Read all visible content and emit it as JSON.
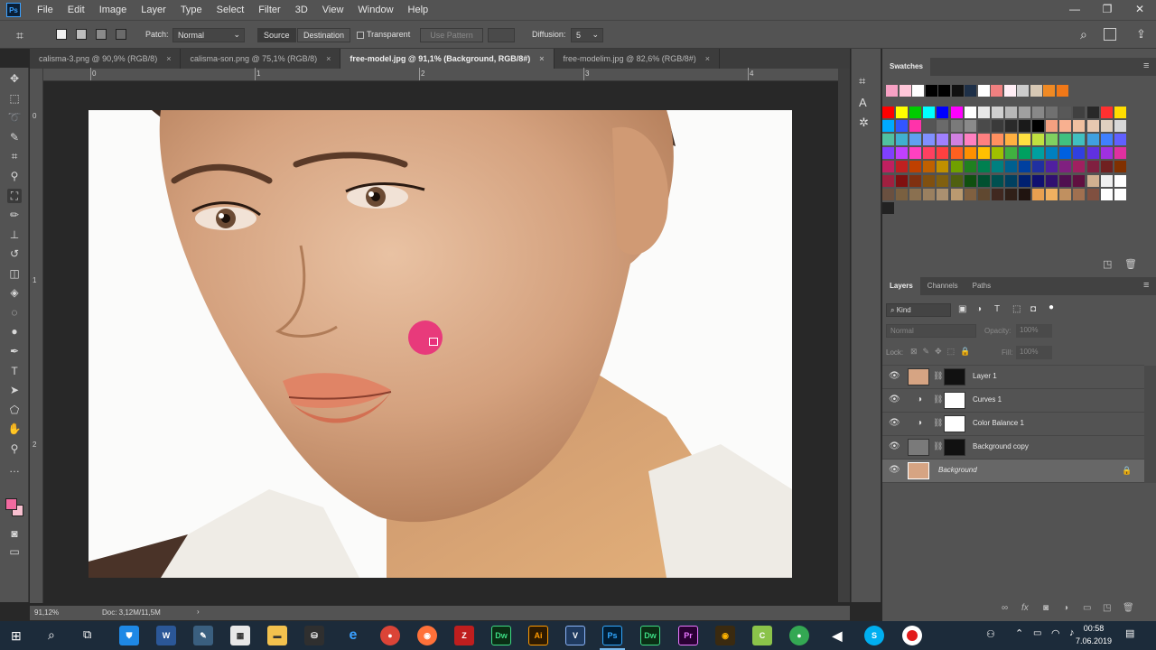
{
  "menubar": {
    "logo": "Ps",
    "items": [
      "File",
      "Edit",
      "Image",
      "Layer",
      "Type",
      "Select",
      "Filter",
      "3D",
      "View",
      "Window",
      "Help"
    ],
    "window_controls": [
      "—",
      "❐",
      "✕"
    ]
  },
  "options": {
    "patch_label": "Patch:",
    "patch_value": "Normal",
    "source_label": "Source",
    "destination_label": "Destination",
    "transparent_label": "Transparent",
    "use_pattern_label": "Use Pattern",
    "diffusion_label": "Diffusion:",
    "diffusion_value": "5"
  },
  "tabs": [
    {
      "label": "calisma-3.png @ 90,9% (RGB/8)",
      "active": false
    },
    {
      "label": "calisma-son.png @ 75,1% (RGB/8)",
      "active": false
    },
    {
      "label": "free-model.jpg @ 91,1% (Background, RGB/8#)",
      "active": true
    },
    {
      "label": "free-modelim.jpg @ 82,6% (RGB/8#)",
      "active": false
    }
  ],
  "rulers": {
    "h": [
      "0",
      "1",
      "2",
      "3",
      "4"
    ],
    "v": [
      "0",
      "1",
      "2"
    ]
  },
  "status": {
    "zoom": "91,12%",
    "doc": "Doc: 3,12M/11,5M"
  },
  "swatches": {
    "title": "Swatches",
    "colors_row1": [
      "#f7a1c4",
      "#ffc7d9",
      "#ffffff",
      "#000000",
      "#000000",
      "#111111",
      "#1e3048",
      "#ffffff",
      "#f08080",
      "#ffeef5",
      "#cccccc",
      "#d7c8b4",
      "#f08a24",
      "#f07818"
    ],
    "grid": [
      [
        "#ff0000",
        "#ffff00",
        "#00cc00",
        "#00ffff",
        "#0000ff",
        "#ff00ff",
        "#ffffff",
        "#e8e8e8",
        "#d0d0d0",
        "#b8b8b8",
        "#a0a0a0",
        "#888888",
        "#707070",
        "#585858",
        "#404040",
        "#282828",
        "#ff3030",
        "#ffdd00"
      ],
      [
        "#00aaff",
        "#3355ff",
        "#ff33aa",
        "#555555",
        "#6a6a6a",
        "#7a7a7a",
        "#8a8a8a",
        "#4a4a4a",
        "#3a3a3a",
        "#2a2a2a",
        "#1a1a1a",
        "#000000",
        "#f4a080",
        "#f8b090",
        "#f0c0a0",
        "#e8c8b0",
        "#e0d0c0",
        "#d8d8d8"
      ],
      [
        "#50c0a0",
        "#40b0d0",
        "#60a0f0",
        "#8090ff",
        "#a080ff",
        "#d080e0",
        "#ff80c0",
        "#ff8080",
        "#ff9060",
        "#ffb040",
        "#ffe040",
        "#c0e040",
        "#80d060",
        "#40c080",
        "#40c0c0",
        "#40a0e0",
        "#4080ff",
        "#6060ff"
      ],
      [
        "#8040ff",
        "#c040ff",
        "#ff40c0",
        "#ff4060",
        "#ff4040",
        "#ff6020",
        "#ff9000",
        "#ffc000",
        "#a0c000",
        "#40b040",
        "#00a060",
        "#00a0a0",
        "#0080c0",
        "#0060e0",
        "#3040e0",
        "#6030e0",
        "#a030e0",
        "#e030a0"
      ],
      [
        "#c02060",
        "#c02020",
        "#c04000",
        "#c06000",
        "#c09000",
        "#70a000",
        "#208020",
        "#008050",
        "#008080",
        "#006090",
        "#0040a0",
        "#2030a0",
        "#5020a0",
        "#802080",
        "#a02060",
        "#802040",
        "#702020",
        "#803000"
      ],
      [
        "#a02040",
        "#801010",
        "#803010",
        "#805010",
        "#806010",
        "#506010",
        "#105010",
        "#005030",
        "#005050",
        "#004060",
        "#002070",
        "#101070",
        "#301070",
        "#501050",
        "#601040",
        "#d0b090",
        "#f0f0f0",
        "#ffffff"
      ],
      [
        "#6a5040",
        "#7a6040",
        "#8a7050",
        "#9a8060",
        "#aa9070",
        "#ba9a70",
        "#806040",
        "#604830",
        "#402820",
        "#302018",
        "#201410",
        "#e8a050",
        "#f0b060",
        "#c09060",
        "#a07050",
        "#805040",
        "#ffffff",
        "#ffffff"
      ]
    ]
  },
  "layers_panel": {
    "tabs": [
      "Layers",
      "Channels",
      "Paths"
    ],
    "kind_label": "Kind",
    "blend_mode": "Normal",
    "opacity_label": "Opacity:",
    "opacity_value": "100%",
    "lock_label": "Lock:",
    "fill_label": "Fill:",
    "fill_value": "100%",
    "layers": [
      {
        "name": "Layer 1",
        "selected": false
      },
      {
        "name": "Curves 1",
        "selected": false
      },
      {
        "name": "Color Balance 1",
        "selected": false
      },
      {
        "name": "Background copy",
        "selected": false
      },
      {
        "name": "Background",
        "selected": true
      }
    ]
  },
  "taskbar": {
    "apps": [
      "Dw",
      "Ai",
      "V",
      "Ps",
      "Dw",
      "Pr"
    ],
    "time": "00:58",
    "date": "7.06.2019"
  }
}
